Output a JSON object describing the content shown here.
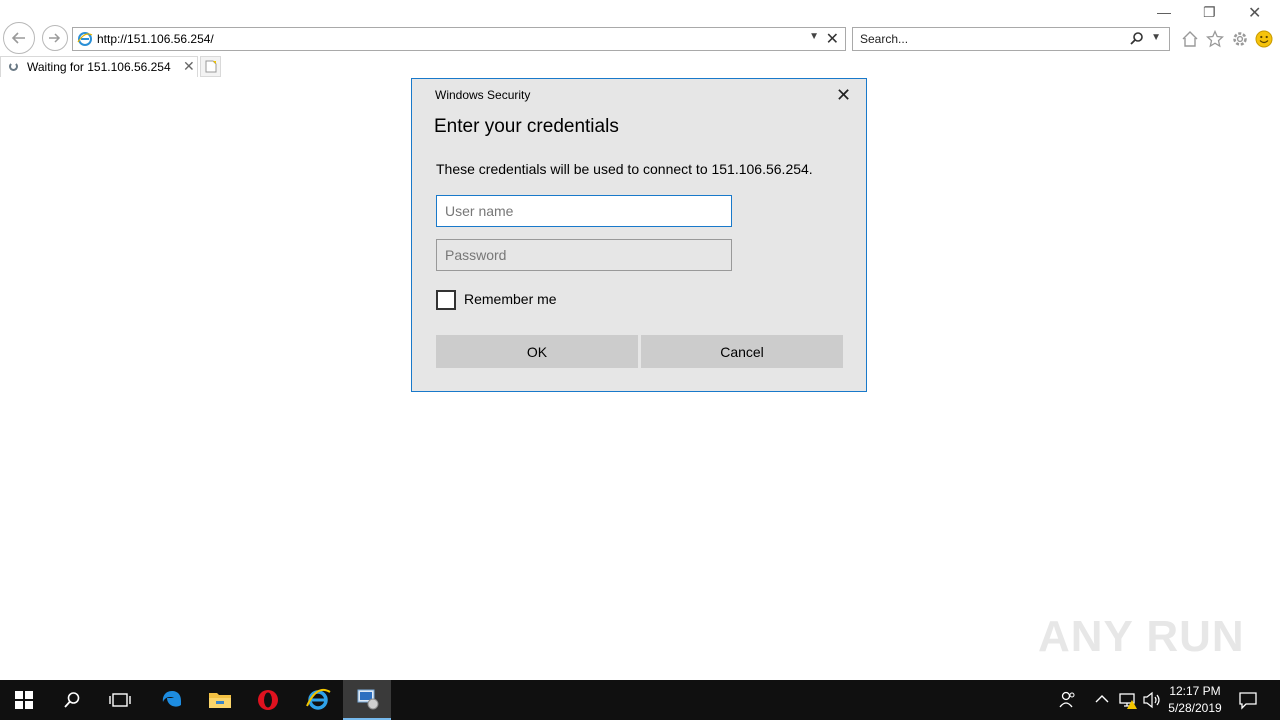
{
  "browser": {
    "address_url": "http://151.106.56.254/",
    "search_placeholder": "Search...",
    "tabs": [
      {
        "title": "Waiting for 151.106.56.254",
        "loading": true
      }
    ]
  },
  "dialog": {
    "caption": "Windows Security",
    "heading": "Enter your credentials",
    "message": "These credentials will be used to connect to 151.106.56.254.",
    "username_placeholder": "User name",
    "password_placeholder": "Password",
    "remember_label": "Remember me",
    "remember_checked": false,
    "ok_label": "OK",
    "cancel_label": "Cancel",
    "accent_color": "#1979ca"
  },
  "watermark": "ANY RUN",
  "taskbar": {
    "pinned": [
      "windows-start-icon",
      "search-icon",
      "task-view-icon",
      "edge-icon",
      "file-explorer-icon",
      "opera-icon",
      "internet-explorer-icon",
      "network-app-icon"
    ],
    "time": "12:17 PM",
    "date": "5/28/2019"
  }
}
